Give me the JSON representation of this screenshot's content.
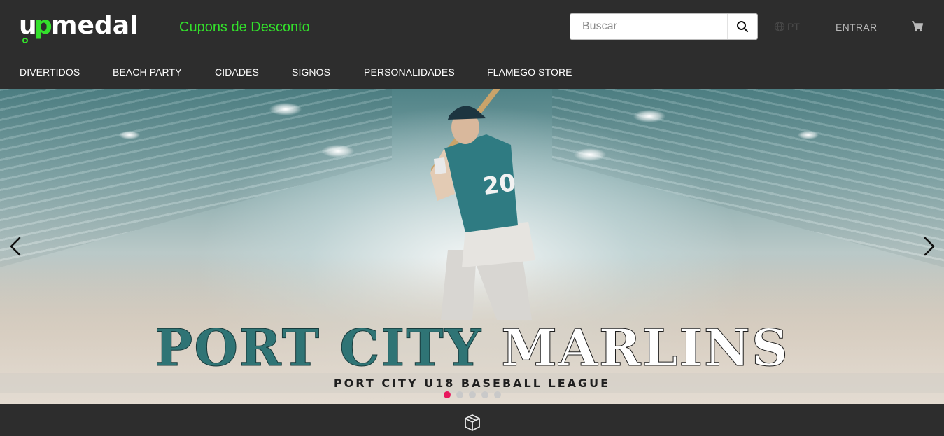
{
  "brand": {
    "logo_text": "upmedal",
    "accent_color": "#33e02b"
  },
  "header": {
    "coupons_link": "Cupons de Desconto",
    "search": {
      "placeholder": "Buscar",
      "value": "",
      "icon": "search-icon"
    },
    "language": {
      "label": "PT",
      "icon": "globe-icon"
    },
    "login_label": "ENTRAR",
    "cart_icon": "cart-icon"
  },
  "nav": {
    "items": [
      {
        "label": "DIVERTIDOS"
      },
      {
        "label": "BEACH PARTY"
      },
      {
        "label": "CIDADES"
      },
      {
        "label": "SIGNOS"
      },
      {
        "label": "PERSONALIDADES"
      },
      {
        "label": "FLAMEGO STORE"
      }
    ]
  },
  "hero": {
    "title_part1": "PORT CITY",
    "title_part2": "MARLINS",
    "subtitle": "PORT CITY U18 BASEBALL LEAGUE",
    "jersey_number": "20",
    "prev_icon": "chevron-left-icon",
    "next_icon": "chevron-right-icon",
    "slides_total": 5,
    "active_slide": 1,
    "active_dot_color": "#e8175d"
  },
  "footer_strip": {
    "icon": "box-icon"
  }
}
